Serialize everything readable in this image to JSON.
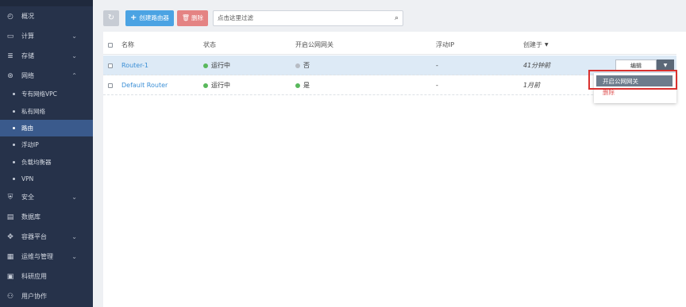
{
  "sidebar": {
    "items": [
      {
        "label": "概况",
        "icon": "dashboard-icon"
      },
      {
        "label": "计算",
        "icon": "monitor-icon"
      },
      {
        "label": "存储",
        "icon": "database-icon"
      },
      {
        "label": "网络",
        "icon": "network-icon"
      }
    ],
    "network_sub": [
      "专有网络VPC",
      "私有网络",
      "路由",
      "浮动IP",
      "负载均衡器",
      "VPN"
    ],
    "active_sub": "路由",
    "items_after": [
      {
        "label": "安全",
        "icon": "shield-icon"
      },
      {
        "label": "数据库",
        "icon": "db-icon"
      },
      {
        "label": "容器平台",
        "icon": "container-icon"
      },
      {
        "label": "运维与管理",
        "icon": "ops-icon"
      },
      {
        "label": "科研应用",
        "icon": "research-icon"
      },
      {
        "label": "用户协作",
        "icon": "users-icon"
      }
    ]
  },
  "toolbar": {
    "create_label": "创建路由器",
    "delete_label": "删除",
    "search_placeholder": "点击这里过滤"
  },
  "table": {
    "headers": {
      "name": "名称",
      "status": "状态",
      "gateway": "开启公网网关",
      "floating_ip": "浮动IP",
      "created": "创建于"
    },
    "rows": [
      {
        "name": "Router-1",
        "status": "运行中",
        "gateway": "否",
        "floating_ip": "-",
        "created": "41分钟前",
        "selected": true
      },
      {
        "name": "Default Router",
        "status": "运行中",
        "gateway": "是",
        "floating_ip": "-",
        "created": "1月前",
        "selected": false
      }
    ]
  },
  "row_actions": {
    "edit_label": "编辑",
    "menu": [
      "开启公网网关",
      "删除"
    ]
  },
  "colors": {
    "sidebar_bg": "#26324a",
    "active_item": "#3a5a8c",
    "primary": "#4ba3e3",
    "danger": "#e48383",
    "status_running": "#58b85c",
    "highlight_border": "#d9302e"
  }
}
